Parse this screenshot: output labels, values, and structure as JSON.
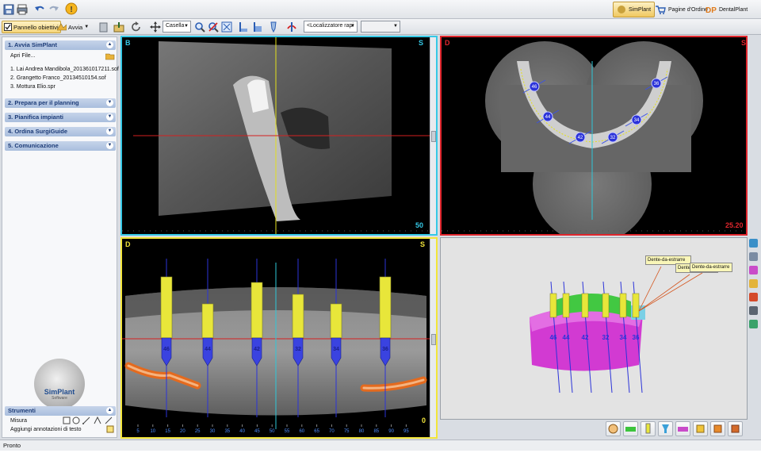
{
  "toolbar": {
    "panel_button": "Pannello obiettivi",
    "start_button": "Avvia",
    "box_dropdown": "Casella",
    "locator_dropdown": "<Localizzatore rapi"
  },
  "modes": {
    "simplant": "SimPlant",
    "order_pages": "Pagine d'Ordine",
    "dentalplant": "DentalPlant"
  },
  "sidebar": {
    "sections": [
      {
        "label": "1. Avvia SimPlant"
      },
      {
        "label": "2. Prepara per il planning"
      },
      {
        "label": "3. Pianifica impianti"
      },
      {
        "label": "4. Ordina SurgiGuide"
      },
      {
        "label": "5. Comunicazione"
      }
    ],
    "open_file": "Apri File...",
    "recent_files": [
      "1. Lai Andrea Mandibola_201361017211.sof",
      "2. Grangetto Franco_20134510154.sof",
      "3. Mottura Elio.spr"
    ],
    "logo_text": "SimPlant",
    "logo_sub": "Software",
    "tools_header": "Strumenti",
    "tools": [
      {
        "label": "Misura"
      },
      {
        "label": "Aggiungi annotazioni di testo"
      }
    ]
  },
  "viewports": {
    "buccal": {
      "left_label": "B",
      "right_label": "S",
      "slice_number": "50"
    },
    "axial": {
      "left_label": "D",
      "right_label": "S",
      "slice_number": "25.20"
    },
    "panoramic": {
      "left_label": "D",
      "right_label": "S",
      "corner_number": "0",
      "ruler_ticks": [
        "5",
        "10",
        "15",
        "20",
        "25",
        "30",
        "35",
        "40",
        "45",
        "50",
        "55",
        "60",
        "65",
        "70",
        "75",
        "80",
        "85",
        "90",
        "95"
      ],
      "implant_labels": [
        "46",
        "44",
        "42",
        "32",
        "34",
        "36"
      ]
    },
    "model3d": {
      "annotations": [
        "Dente-da-estrarre",
        "Dente-da-estrarre",
        "Dente-da-estrarre"
      ],
      "implant_labels": [
        "46",
        "44",
        "42",
        "32",
        "34",
        "36"
      ]
    }
  },
  "axial_implant_labels": [
    "46",
    "44",
    "42",
    "32",
    "34",
    "36"
  ],
  "status": {
    "text": "Pronto"
  },
  "colors": {
    "buccal_border": "#35c8e6",
    "axial_border": "#e0262d",
    "panoramic_border": "#f2e53a",
    "model_bg": "#e3e3e3",
    "implant_yellow": "#e8e63a",
    "implant_blue": "#2b33d9"
  }
}
